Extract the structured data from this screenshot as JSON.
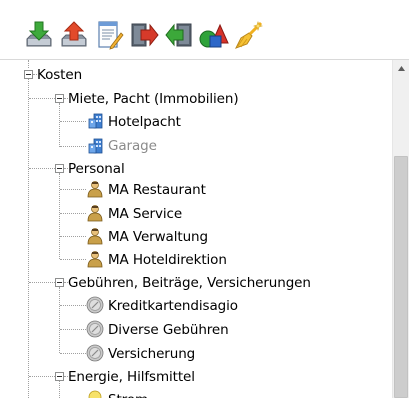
{
  "toolbar": {
    "buttons": [
      {
        "id": "download-tool-button",
        "icon": "download-tray-icon"
      },
      {
        "id": "upload-tool-button",
        "icon": "upload-tray-icon"
      },
      {
        "id": "edit-tool-button",
        "icon": "edit-document-icon"
      },
      {
        "id": "export-tool-button",
        "icon": "export-red-arrow-icon"
      },
      {
        "id": "import-tool-button",
        "icon": "import-green-arrow-icon"
      },
      {
        "id": "shapes-tool-button",
        "icon": "shapes-icon"
      },
      {
        "id": "cleanup-tool-button",
        "icon": "broom-wand-icon"
      }
    ]
  },
  "tree": {
    "root": {
      "label": "Kosten",
      "groups": [
        {
          "label": "Miete, Pacht (Immobilien)",
          "items": [
            {
              "label": "Hotelpacht",
              "icon": "building-blue-icon",
              "disabled": false
            },
            {
              "label": "Garage",
              "icon": "building-blue-icon",
              "disabled": true
            }
          ]
        },
        {
          "label": "Personal",
          "items": [
            {
              "label": "MA Restaurant",
              "icon": "person-icon"
            },
            {
              "label": "MA Service",
              "icon": "person-icon"
            },
            {
              "label": "MA Verwaltung",
              "icon": "person-icon"
            },
            {
              "label": "MA Hoteldirektion",
              "icon": "person-icon"
            }
          ]
        },
        {
          "label": "Gebühren, Beiträge, Versicherungen",
          "items": [
            {
              "label": "Kreditkartendisagio",
              "icon": "coin-icon"
            },
            {
              "label": "Diverse Gebühren",
              "icon": "coin-icon"
            },
            {
              "label": "Versicherung",
              "icon": "coin-icon"
            }
          ]
        },
        {
          "label": "Energie, Hilfsmittel",
          "items": [
            {
              "label": "Strom",
              "icon": "lightbulb-icon"
            }
          ]
        }
      ]
    }
  },
  "colors": {
    "accent_blue": "#2f6fc1",
    "tree_line": "#a0a0a0",
    "disabled_text": "#8a8a8a"
  }
}
